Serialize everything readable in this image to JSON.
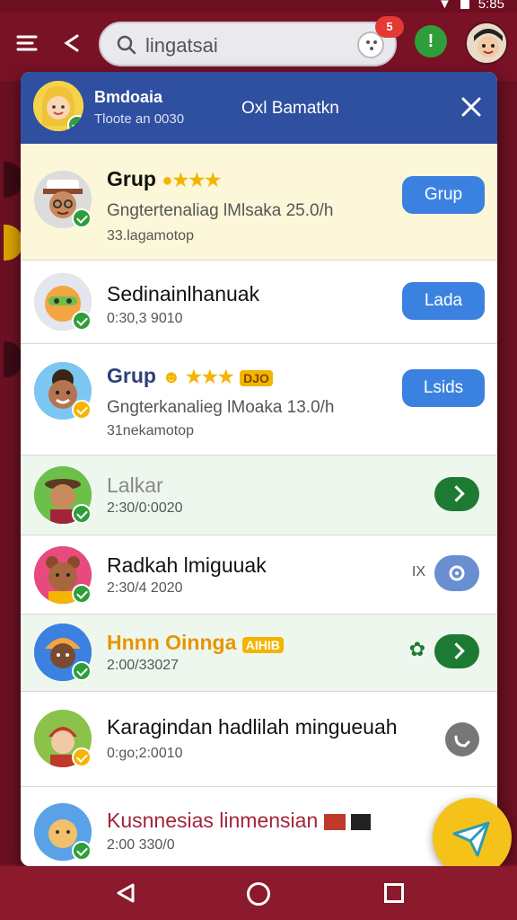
{
  "status_bar": {
    "time": "5:85"
  },
  "search": {
    "query": "lingatsai",
    "notification_count": "5"
  },
  "dialog": {
    "header": {
      "title": "Bmdoaia",
      "subtitle": "Tloote an 0030",
      "center_text": "Oxl Bamatkn"
    },
    "rows": [
      {
        "name": "Grup",
        "sub": "Gngtertenaliag lMlsaka 25.0/h",
        "meta": "33.lagamotop",
        "button": "Grup",
        "highlight": "#fbf7d8"
      },
      {
        "name": "Sedinainlhanuak",
        "sub": "",
        "meta": "0:30,3 9010",
        "button": "Lada",
        "highlight": "#ffffff"
      },
      {
        "name": "Grup",
        "sub": "Gngterkanalieg lMoaka 13.0/h",
        "meta": "31nekamotop",
        "button": "Lsids",
        "tag": "DJO",
        "highlight": "#ffffff"
      },
      {
        "name": "Lalkar",
        "sub": "",
        "meta": "2:30/0:0020",
        "button": "",
        "highlight": "#eef7ee"
      },
      {
        "name": "Radkah lmiguuak",
        "sub": "",
        "meta": "2:30/4 2020",
        "button": "",
        "side_text": "IX",
        "highlight": "#ffffff"
      },
      {
        "name": "Hnnn Oinnga",
        "sub": "",
        "meta": "2:00/33027",
        "button": "",
        "tag": "AIHIB",
        "highlight": "#eef7ee"
      },
      {
        "name": "Karagindan hadlilah mingueuah",
        "sub": "",
        "meta": "0:go;2:0010",
        "button": "",
        "highlight": "#ffffff"
      },
      {
        "name": "Kusnnesias linmensian",
        "sub": "",
        "meta": "2:00 330/0",
        "button": "",
        "highlight": "#ffffff"
      }
    ]
  }
}
